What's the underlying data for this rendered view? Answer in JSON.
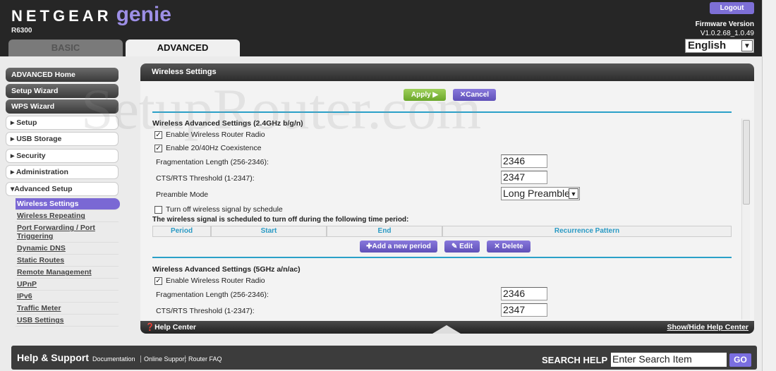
{
  "brand": {
    "logo": "NETGEAR",
    "product": "genie",
    "model": "R6300"
  },
  "tabs": [
    {
      "label": "BASIC"
    },
    {
      "label": "ADVANCED",
      "active": true
    }
  ],
  "header": {
    "logout": "Logout",
    "firmware_label": "Firmware Version",
    "firmware_version": "V1.0.2.68_1.0.49",
    "language": "English"
  },
  "sidebar": {
    "buttons": [
      "ADVANCED Home",
      "Setup Wizard",
      "WPS Wizard"
    ],
    "groups": [
      "Setup",
      "USB Storage",
      "Security",
      "Administration",
      "Advanced Setup"
    ],
    "sub_items": [
      "Wireless Settings",
      "Wireless Repeating",
      "Port Forwarding / Port Triggering",
      "Dynamic DNS",
      "Static Routes",
      "Remote Management",
      "UPnP",
      "IPv6",
      "Traffic Meter",
      "USB Settings"
    ],
    "active": "Wireless Settings"
  },
  "panel": {
    "title": "Wireless Settings",
    "apply": "Apply ▶",
    "cancel": "✕Cancel",
    "section24": {
      "title": "Wireless Advanced Settings (2.4GHz b/g/n)",
      "enable_radio": "Enable Wireless Router Radio",
      "enable_radio_checked": true,
      "coexistence": "Enable 20/40Hz Coexistence",
      "coexistence_checked": true,
      "frag_label": "Fragmentation Length (256-2346):",
      "frag_value": "2346",
      "cts_label": "CTS/RTS Threshold (1-2347):",
      "cts_value": "2347",
      "preamble_label": "Preamble Mode",
      "preamble_value": "Long Preamble",
      "schedule_label": "Turn off wireless signal by schedule",
      "schedule_checked": false,
      "schedule_note": "The wireless signal is scheduled to turn off during the following time period:",
      "columns": [
        "Period",
        "Start",
        "End",
        "Recurrence Pattern"
      ],
      "add": "Add a new period",
      "edit": "Edit",
      "delete": "Delete"
    },
    "section5": {
      "title": "Wireless Advanced Settings (5GHz a/n/ac)",
      "enable_radio": "Enable Wireless Router Radio",
      "enable_radio_checked": true,
      "frag_label": "Fragmentation Length (256-2346):",
      "frag_value": "2346",
      "cts_label": "CTS/RTS Threshold (1-2347):",
      "cts_value": "2347"
    },
    "help_center": "Help Center",
    "show_hide": "Show/Hide Help Center"
  },
  "footer": {
    "title": "Help & Support",
    "links": [
      "Documentation",
      "Online Support",
      "Router FAQ"
    ],
    "search_label": "SEARCH HELP",
    "search_placeholder": "Enter Search Item",
    "go": "GO"
  },
  "watermark": "SetupRouter.com",
  "colors": {
    "accent": "#7a68d4",
    "apply": "#7fb83e",
    "rule": "#2aa0c8",
    "header": "#262626"
  }
}
